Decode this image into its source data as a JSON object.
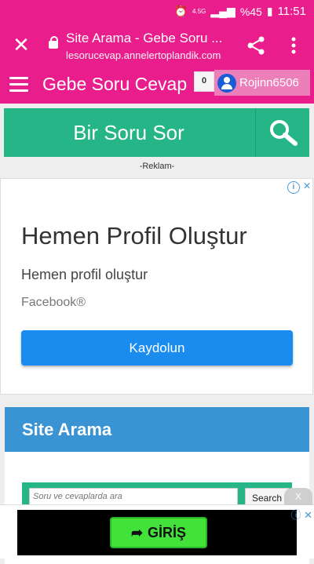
{
  "status_bar": {
    "network": "4.5G",
    "battery": "%45",
    "time": "11:51"
  },
  "browser": {
    "page_title": "Site Arama - Gebe Soru ...",
    "url": "lesorucevap.annelertoplandik.com",
    "close_icon": "close-icon",
    "share_icon": "share-icon",
    "more_icon": "more-vert-icon"
  },
  "header": {
    "site_name": "Gebe Soru Cevap",
    "notifications": "0",
    "username": "Rojinn6506"
  },
  "ask": {
    "label": "Bir Soru Sor"
  },
  "reklam": "-Reklam-",
  "ad": {
    "headline": "Hemen Profil Oluştur",
    "subtitle": "Hemen profil oluştur",
    "brand": "Facebook®",
    "cta": "Kaydolun"
  },
  "search_section": {
    "title": "Site Arama",
    "placeholder": "Soru ve cevaplarda ara",
    "button": "Search"
  },
  "bottom_ad": {
    "close": "X",
    "cta": "GİRİŞ"
  },
  "colors": {
    "brand_pink": "#e91e8c",
    "green": "#26b587",
    "blue": "#3a93d3"
  }
}
